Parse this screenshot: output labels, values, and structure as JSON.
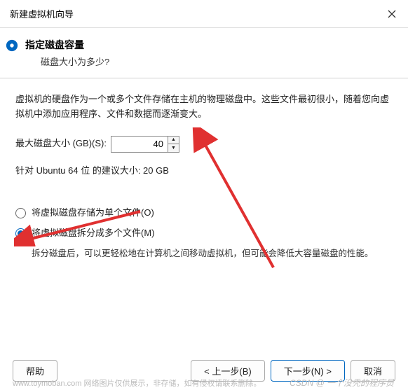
{
  "titlebar": {
    "title": "新建虚拟机向导"
  },
  "header": {
    "title": "指定磁盘容量",
    "subtitle": "磁盘大小为多少?"
  },
  "content": {
    "intro": "虚拟机的硬盘作为一个或多个文件存储在主机的物理磁盘中。这些文件最初很小，随着您向虚拟机中添加应用程序、文件和数据而逐渐变大。",
    "max_size_label": "最大磁盘大小 (GB)(S):",
    "max_size_value": "40",
    "recommend": "针对 Ubuntu 64 位 的建议大小: 20 GB",
    "radio_single": "将虚拟磁盘存储为单个文件(O)",
    "radio_split": "将虚拟磁盘拆分成多个文件(M)",
    "split_desc": "拆分磁盘后，可以更轻松地在计算机之间移动虚拟机，但可能会降低大容量磁盘的性能。"
  },
  "footer": {
    "help": "帮助",
    "back": "< 上一步(B)",
    "next": "下一步(N) >",
    "cancel": "取消"
  },
  "watermark": {
    "left": "www.toymoban.com  网络图片仅供展示，非存储，如有侵权请联系删除。",
    "right": "CSDN @ 一个没秃的程序员"
  }
}
